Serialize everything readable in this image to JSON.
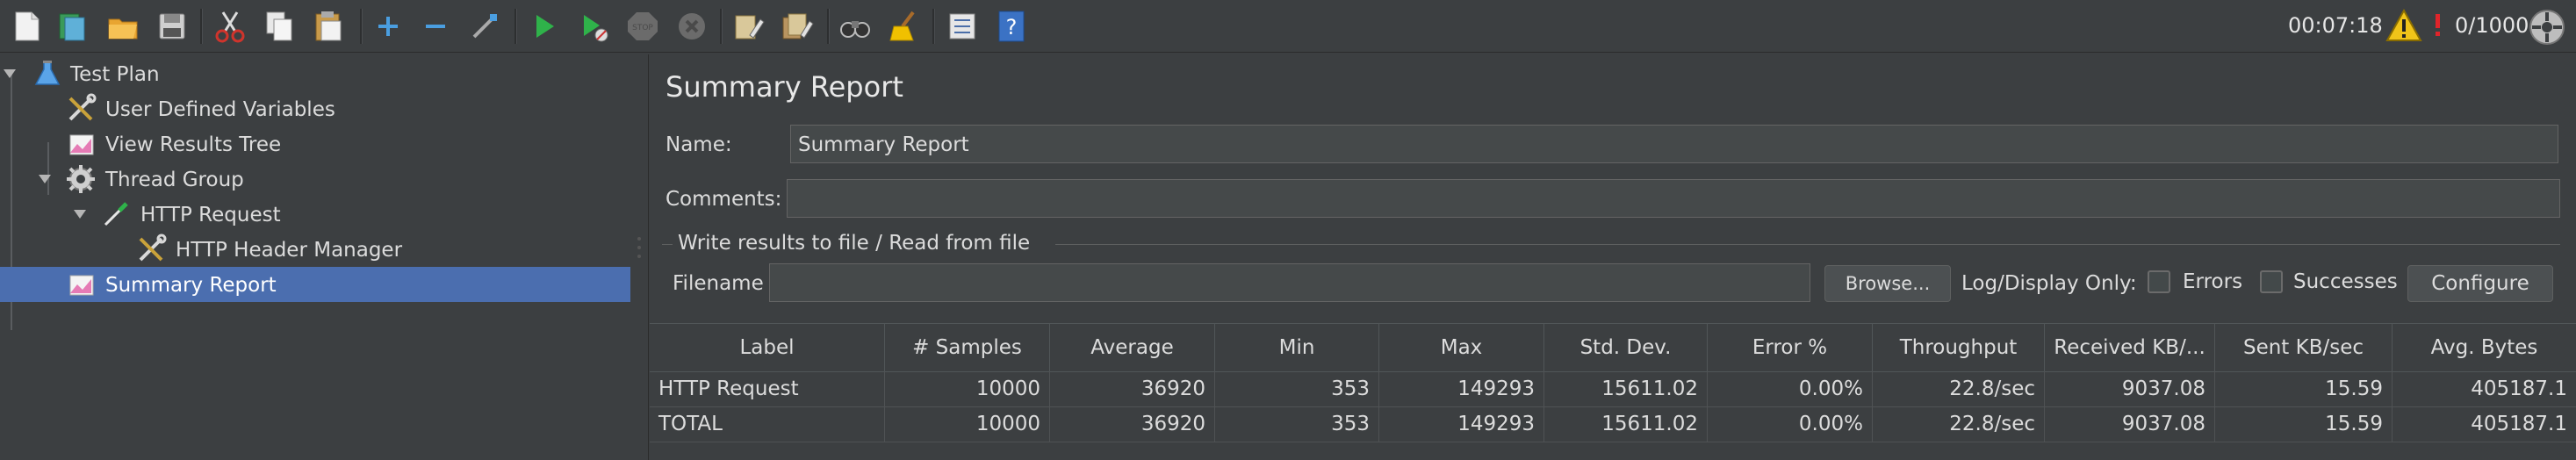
{
  "toolbar": {
    "icons": [
      "new-icon",
      "templates-icon",
      "open-icon",
      "save-icon",
      "cut-icon",
      "copy-icon",
      "paste-icon",
      "expand-icon",
      "collapse-icon",
      "toggle-icon",
      "start-icon",
      "start-no-pause-icon",
      "stop-icon",
      "shutdown-icon",
      "clear-icon",
      "clear-all-icon",
      "search-icon",
      "reset-search-icon",
      "function-helper-icon",
      "help-icon"
    ],
    "timer": "00:07:18",
    "threads": "0/1000"
  },
  "tree": {
    "items": [
      {
        "label": "Test Plan"
      },
      {
        "label": "User Defined Variables"
      },
      {
        "label": "View Results Tree"
      },
      {
        "label": "Thread Group"
      },
      {
        "label": "HTTP Request"
      },
      {
        "label": "HTTP Header Manager"
      },
      {
        "label": "Summary Report"
      }
    ],
    "selected_index": 6
  },
  "panel": {
    "title": "Summary Report",
    "name_label": "Name:",
    "name_value": "Summary Report",
    "comments_label": "Comments:",
    "comments_value": "",
    "file_group_label": "Write results to file / Read from file",
    "filename_label": "Filename",
    "filename_value": "",
    "browse_label": "Browse...",
    "log_display_label": "Log/Display Only:",
    "errors_label": "Errors",
    "successes_label": "Successes",
    "configure_label": "Configure"
  },
  "table": {
    "columns": [
      "Label",
      "# Samples",
      "Average",
      "Min",
      "Max",
      "Std. Dev.",
      "Error %",
      "Throughput",
      "Received KB/...",
      "Sent KB/sec",
      "Avg. Bytes"
    ],
    "rows": [
      [
        "HTTP Request",
        "10000",
        "36920",
        "353",
        "149293",
        "15611.02",
        "0.00%",
        "22.8/sec",
        "9037.08",
        "15.59",
        "405187.1"
      ],
      [
        "TOTAL",
        "10000",
        "36920",
        "353",
        "149293",
        "15611.02",
        "0.00%",
        "22.8/sec",
        "9037.08",
        "15.59",
        "405187.1"
      ]
    ]
  }
}
